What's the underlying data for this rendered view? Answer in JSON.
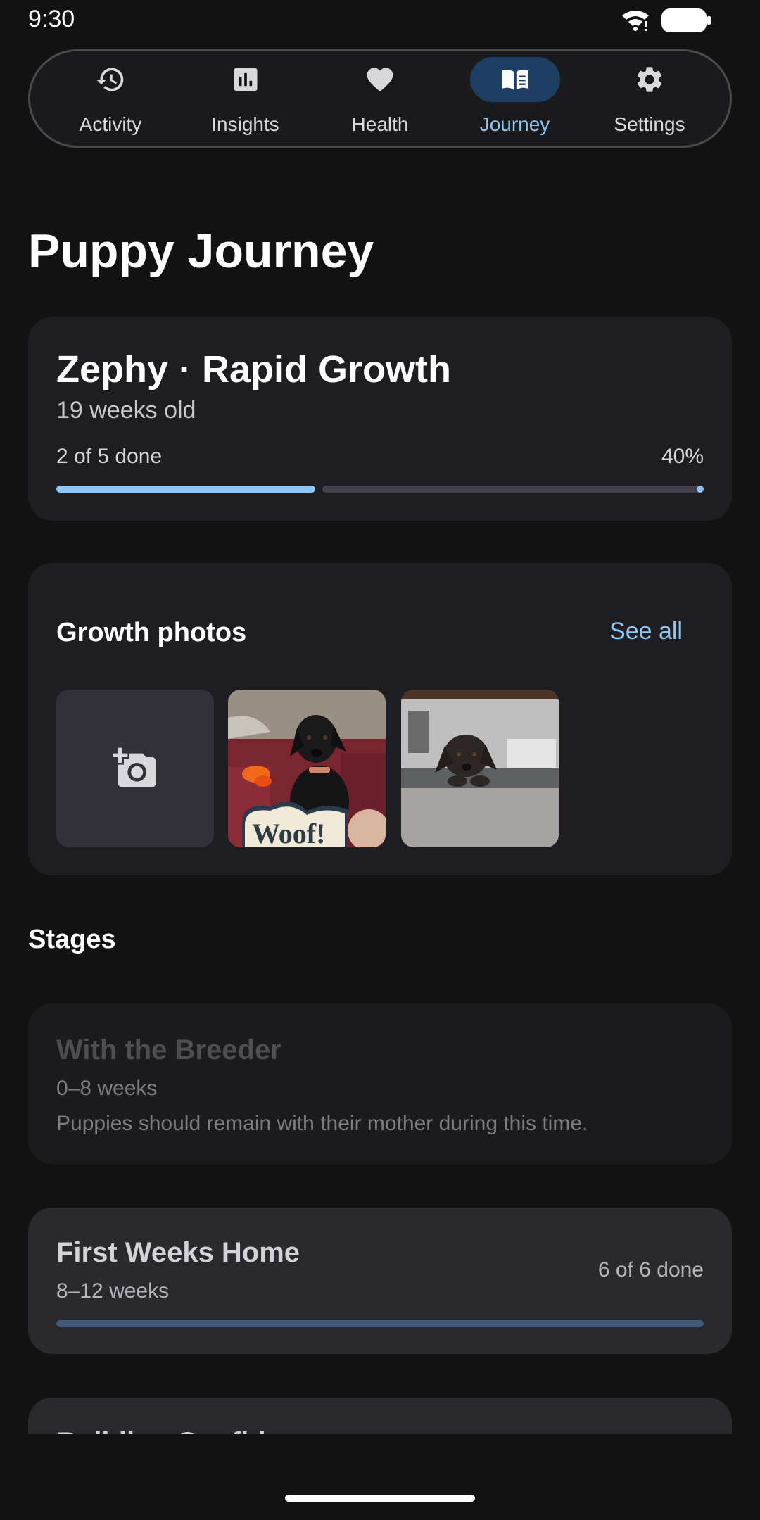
{
  "status_bar": {
    "time": "9:30"
  },
  "nav": {
    "items": [
      {
        "label": "Activity",
        "icon": "history-icon",
        "active": false
      },
      {
        "label": "Insights",
        "icon": "bar-chart-icon",
        "active": false
      },
      {
        "label": "Health",
        "icon": "heart-icon",
        "active": false
      },
      {
        "label": "Journey",
        "icon": "book-icon",
        "active": true
      },
      {
        "label": "Settings",
        "icon": "gear-icon",
        "active": false
      }
    ],
    "accent_color": "#8ec5f3"
  },
  "page": {
    "title": "Puppy Journey"
  },
  "summary": {
    "title": "Zephy · Rapid Growth",
    "age": "19 weeks old",
    "done_text": "2 of 5 done",
    "percent_text": "40%",
    "progress": 0.4
  },
  "photos": {
    "title": "Growth photos",
    "see_all": "See all",
    "add_icon": "add-photo-icon",
    "items": [
      {
        "alt": "Black puppy on red couch with Woof! sign",
        "caption_in_photo": "Woof!"
      },
      {
        "alt": "Black puppy lying under a table"
      }
    ]
  },
  "stages": {
    "title": "Stages",
    "items": [
      {
        "name": "With the Breeder",
        "range": "0–8 weeks",
        "description": "Puppies should remain with their mother during this time.",
        "state": "disabled"
      },
      {
        "name": "First Weeks Home",
        "range": "8–12 weeks",
        "done_text": "6 of 6 done",
        "progress": 1.0,
        "state": "complete"
      },
      {
        "name": "Building Confidence",
        "state": "partially-visible"
      }
    ]
  }
}
